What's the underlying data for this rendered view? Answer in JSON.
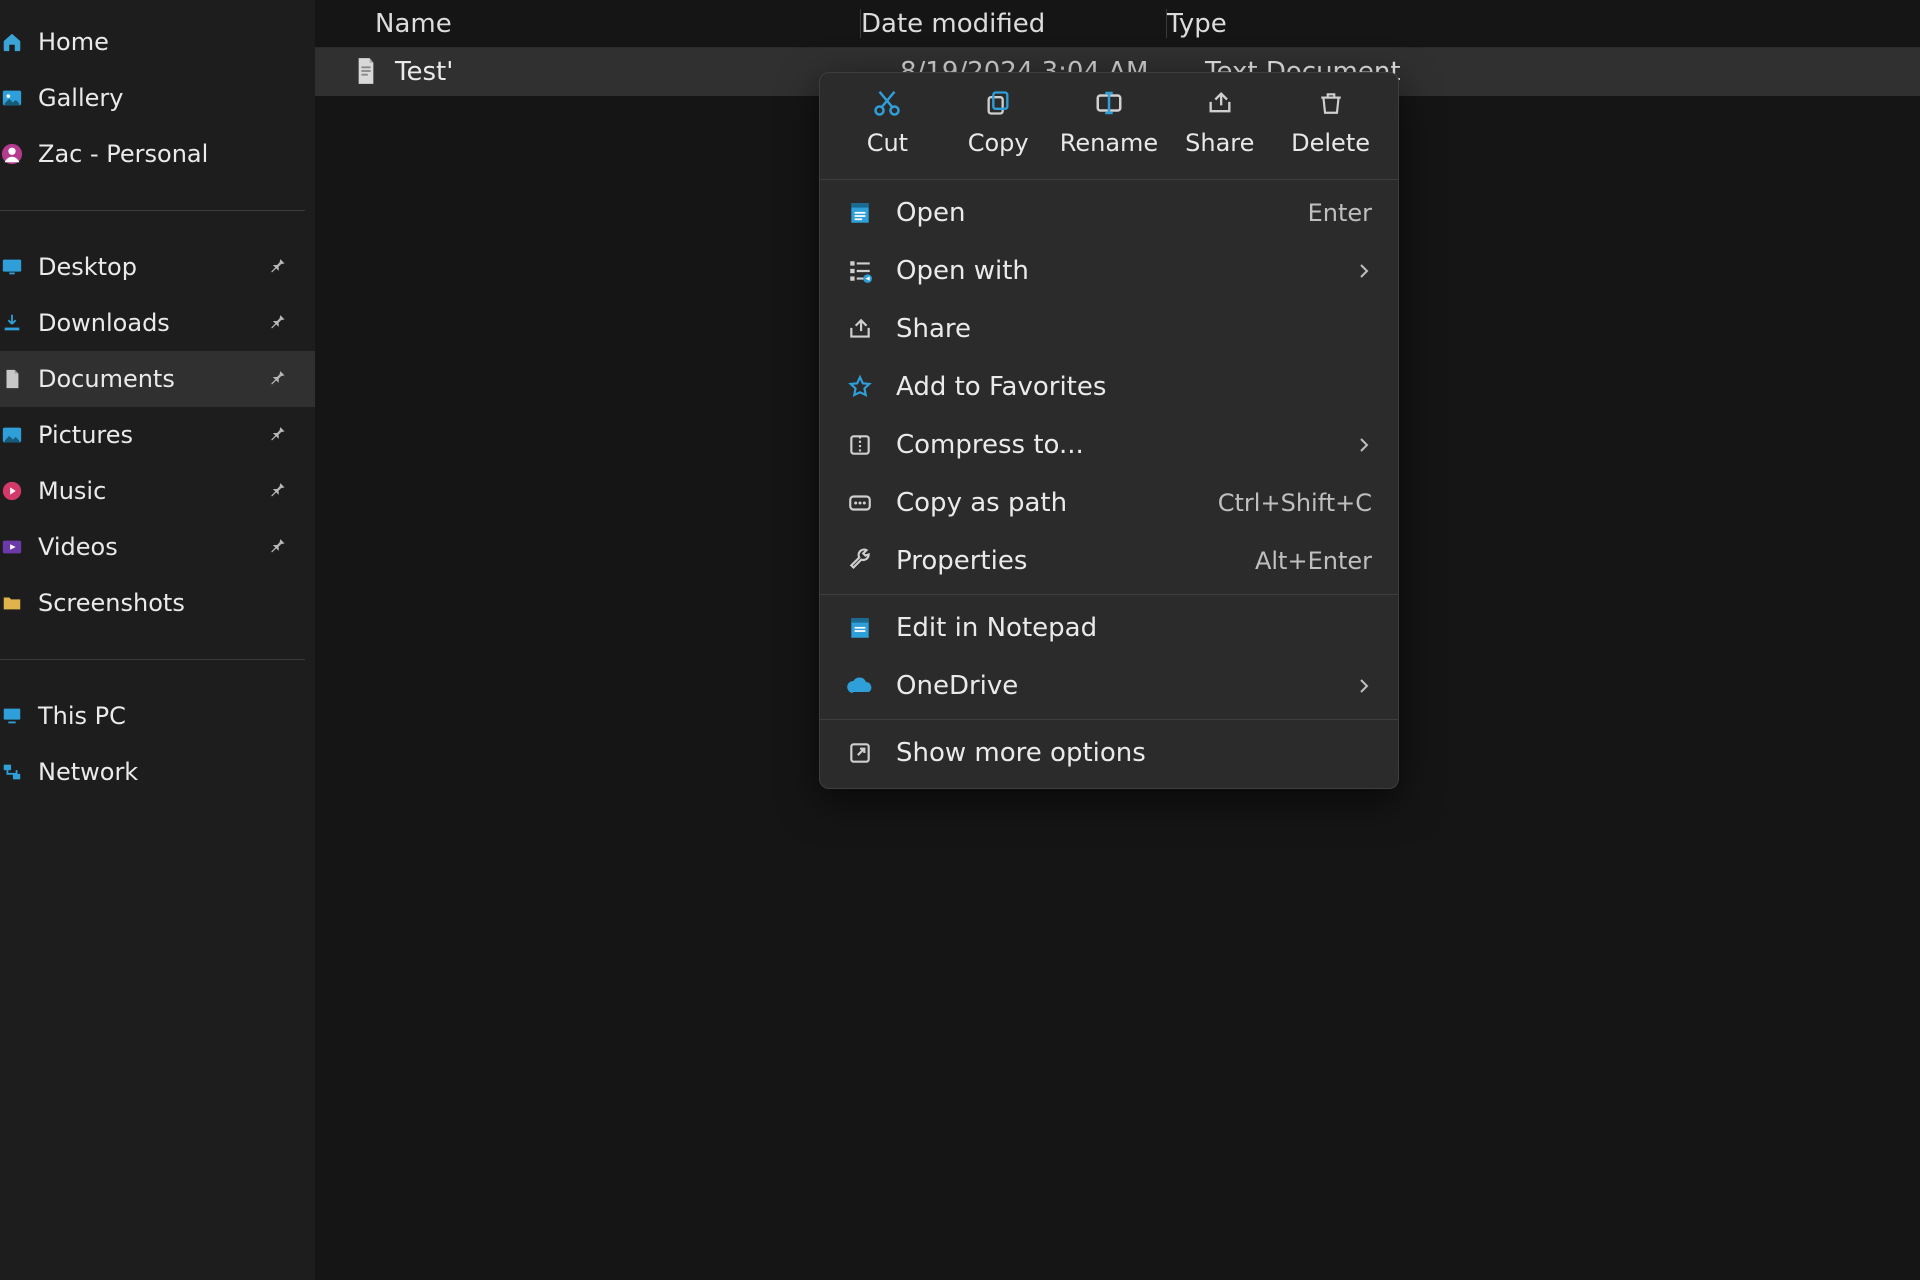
{
  "sidebar": {
    "top": [
      {
        "label": "Home"
      },
      {
        "label": "Gallery"
      },
      {
        "label": "Zac - Personal"
      }
    ],
    "pinned": [
      {
        "label": "Desktop"
      },
      {
        "label": "Downloads"
      },
      {
        "label": "Documents",
        "selected": true
      },
      {
        "label": "Pictures"
      },
      {
        "label": "Music"
      },
      {
        "label": "Videos"
      },
      {
        "label": "Screenshots"
      }
    ],
    "bottom": [
      {
        "label": "This PC"
      },
      {
        "label": "Network"
      }
    ]
  },
  "columns": {
    "name": "Name",
    "date": "Date modified",
    "type": "Type"
  },
  "file": {
    "name": "Test'",
    "date": "8/19/2024 3:04 AM",
    "type": "Text Document"
  },
  "ctx": {
    "actions": {
      "cut": "Cut",
      "copy": "Copy",
      "rename": "Rename",
      "share": "Share",
      "delete": "Delete"
    },
    "open": {
      "label": "Open",
      "hint": "Enter"
    },
    "open_with": {
      "label": "Open with"
    },
    "share": {
      "label": "Share"
    },
    "favorites": {
      "label": "Add to Favorites"
    },
    "compress": {
      "label": "Compress to..."
    },
    "copy_path": {
      "label": "Copy as path",
      "hint": "Ctrl+Shift+C"
    },
    "properties": {
      "label": "Properties",
      "hint": "Alt+Enter"
    },
    "edit_notepad": {
      "label": "Edit in Notepad"
    },
    "onedrive": {
      "label": "OneDrive"
    },
    "more": {
      "label": "Show more options"
    }
  }
}
